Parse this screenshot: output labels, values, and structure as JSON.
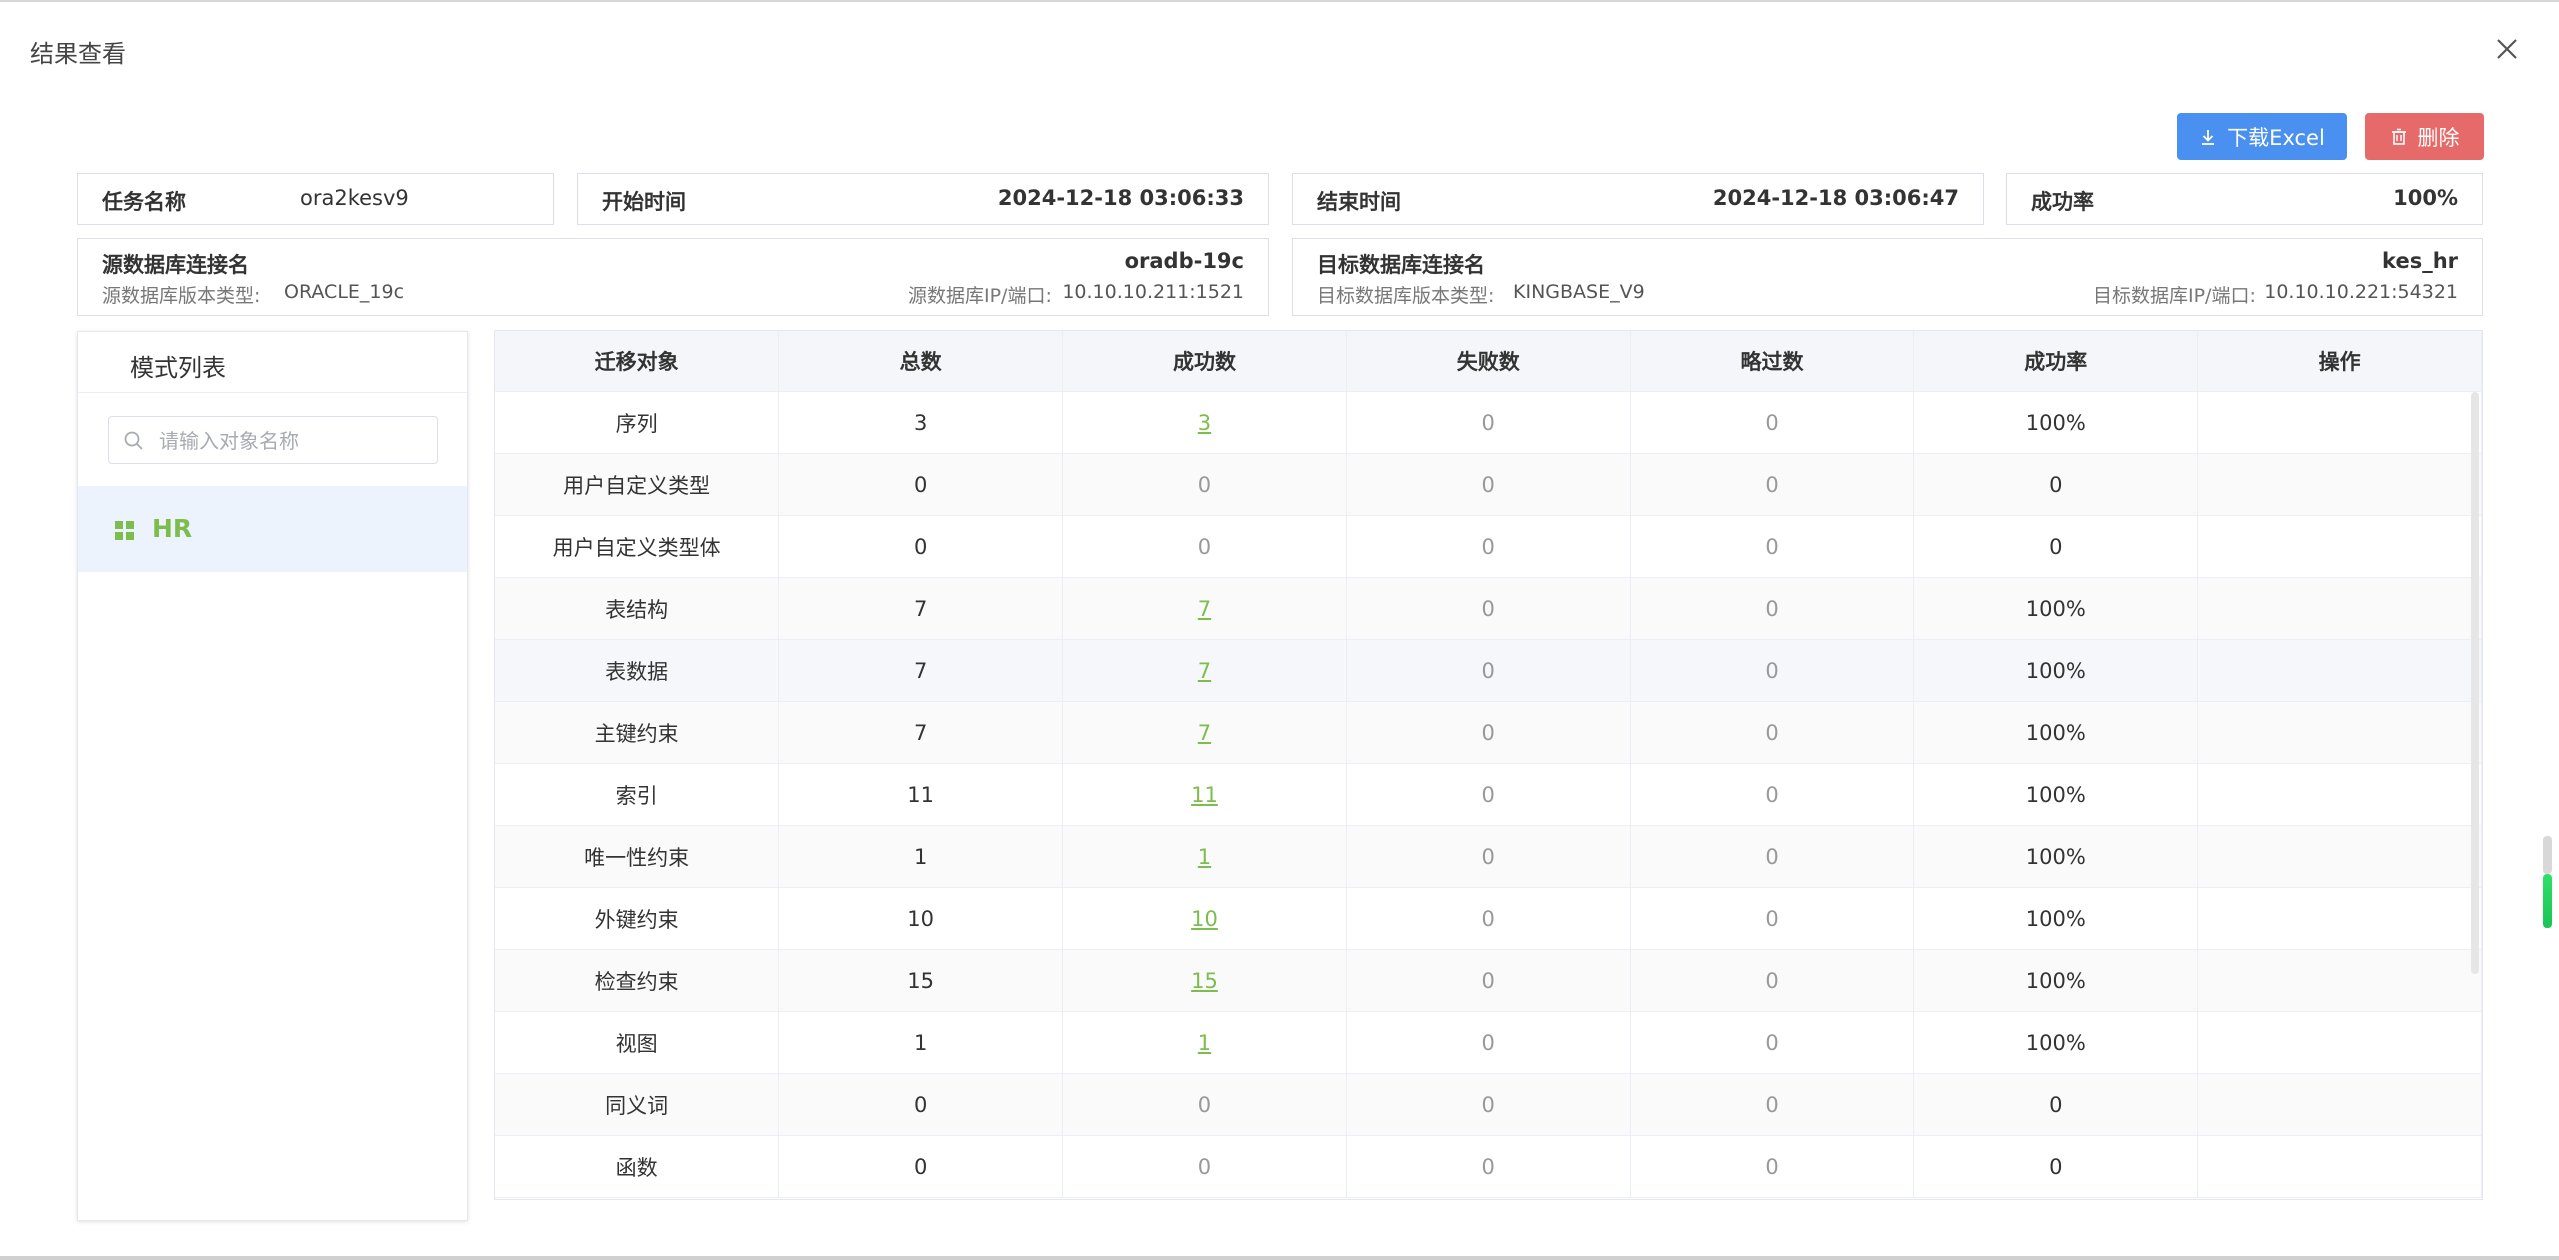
{
  "dialog": {
    "title": "结果查看"
  },
  "toolbar": {
    "download_label": "下载Excel",
    "delete_label": "删除"
  },
  "task": {
    "name_label": "任务名称",
    "name_value": "ora2kesv9",
    "start_label": "开始时间",
    "start_value": "2024-12-18 03:06:33",
    "end_label": "结束时间",
    "end_value": "2024-12-18 03:06:47",
    "rate_label": "成功率",
    "rate_value": "100%"
  },
  "source": {
    "conn_label": "源数据库连接名",
    "conn_value": "oradb-19c",
    "version_label": "源数据库版本类型:",
    "version_value": "ORACLE_19c",
    "ip_label": "源数据库IP/端口:",
    "ip_value": "10.10.10.211:1521"
  },
  "target": {
    "conn_label": "目标数据库连接名",
    "conn_value": "kes_hr",
    "version_label": "目标数据库版本类型:",
    "version_value": "KINGBASE_V9",
    "ip_label": "目标数据库IP/端口:",
    "ip_value": "10.10.10.221:54321"
  },
  "sidebar": {
    "title": "模式列表",
    "search_placeholder": "请输入对象名称",
    "items": [
      {
        "label": "HR"
      }
    ]
  },
  "table": {
    "headers": [
      "迁移对象",
      "总数",
      "成功数",
      "失败数",
      "略过数",
      "成功率",
      "操作"
    ],
    "rows": [
      {
        "object": "序列",
        "total": "3",
        "success": "3",
        "failed": "0",
        "skipped": "0",
        "rate": "100%"
      },
      {
        "object": "用户自定义类型",
        "total": "0",
        "success": "0",
        "failed": "0",
        "skipped": "0",
        "rate": "0"
      },
      {
        "object": "用户自定义类型体",
        "total": "0",
        "success": "0",
        "failed": "0",
        "skipped": "0",
        "rate": "0"
      },
      {
        "object": "表结构",
        "total": "7",
        "success": "7",
        "failed": "0",
        "skipped": "0",
        "rate": "100%"
      },
      {
        "object": "表数据",
        "total": "7",
        "success": "7",
        "failed": "0",
        "skipped": "0",
        "rate": "100%"
      },
      {
        "object": "主键约束",
        "total": "7",
        "success": "7",
        "failed": "0",
        "skipped": "0",
        "rate": "100%"
      },
      {
        "object": "索引",
        "total": "11",
        "success": "11",
        "failed": "0",
        "skipped": "0",
        "rate": "100%"
      },
      {
        "object": "唯一性约束",
        "total": "1",
        "success": "1",
        "failed": "0",
        "skipped": "0",
        "rate": "100%"
      },
      {
        "object": "外键约束",
        "total": "10",
        "success": "10",
        "failed": "0",
        "skipped": "0",
        "rate": "100%"
      },
      {
        "object": "检查约束",
        "total": "15",
        "success": "15",
        "failed": "0",
        "skipped": "0",
        "rate": "100%"
      },
      {
        "object": "视图",
        "total": "1",
        "success": "1",
        "failed": "0",
        "skipped": "0",
        "rate": "100%"
      },
      {
        "object": "同义词",
        "total": "0",
        "success": "0",
        "failed": "0",
        "skipped": "0",
        "rate": "0"
      },
      {
        "object": "函数",
        "total": "0",
        "success": "0",
        "failed": "0",
        "skipped": "0",
        "rate": "0"
      }
    ]
  },
  "colors": {
    "primary": "#4a90f0",
    "danger": "#e76a6a",
    "success_link": "#7dbd4e"
  }
}
